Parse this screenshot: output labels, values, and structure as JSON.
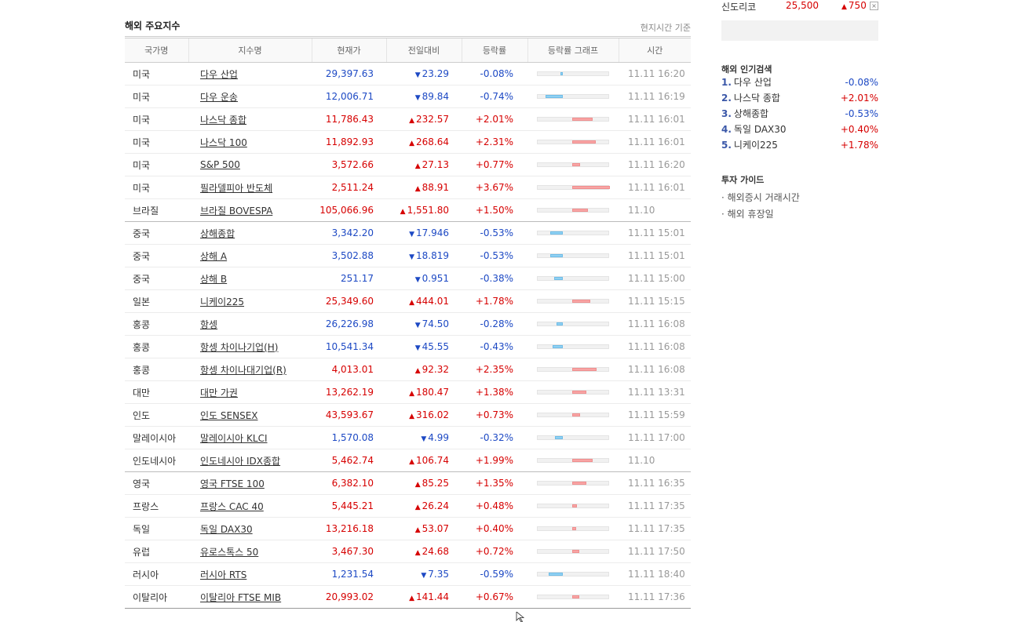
{
  "main": {
    "title": "해외 주요지수",
    "note": "현지시간 기준",
    "columns": [
      "국가명",
      "지수명",
      "현재가",
      "전일대비",
      "등락률",
      "등락률 그래프",
      "시간"
    ],
    "rows": [
      {
        "country": "미국",
        "name": "다우 산업",
        "price": "29,397.63",
        "dir": "dn",
        "change": "23.29",
        "rate": "-0.08%",
        "time": "11.11 16:20"
      },
      {
        "country": "미국",
        "name": "다우 운송",
        "price": "12,006.71",
        "dir": "dn",
        "change": "89.84",
        "rate": "-0.74%",
        "time": "11.11 16:19"
      },
      {
        "country": "미국",
        "name": "나스닥 종합",
        "price": "11,786.43",
        "dir": "up",
        "change": "232.57",
        "rate": "+2.01%",
        "time": "11.11 16:01"
      },
      {
        "country": "미국",
        "name": "나스닥 100",
        "price": "11,892.93",
        "dir": "up",
        "change": "268.64",
        "rate": "+2.31%",
        "time": "11.11 16:01"
      },
      {
        "country": "미국",
        "name": "S&P 500",
        "price": "3,572.66",
        "dir": "up",
        "change": "27.13",
        "rate": "+0.77%",
        "time": "11.11 16:20"
      },
      {
        "country": "미국",
        "name": "필라델피아 반도체",
        "price": "2,511.24",
        "dir": "up",
        "change": "88.91",
        "rate": "+3.67%",
        "time": "11.11 16:01"
      },
      {
        "country": "브라질",
        "name": "브라질 BOVESPA",
        "price": "105,066.96",
        "dir": "up",
        "change": "1,551.80",
        "rate": "+1.50%",
        "time": "11.10",
        "sep": true
      },
      {
        "country": "중국",
        "name": "상해종합",
        "price": "3,342.20",
        "dir": "dn",
        "change": "17.946",
        "rate": "-0.53%",
        "time": "11.11 15:01"
      },
      {
        "country": "중국",
        "name": "상해 A",
        "price": "3,502.88",
        "dir": "dn",
        "change": "18.819",
        "rate": "-0.53%",
        "time": "11.11 15:01"
      },
      {
        "country": "중국",
        "name": "상해 B",
        "price": "251.17",
        "dir": "dn",
        "change": "0.951",
        "rate": "-0.38%",
        "time": "11.11 15:00"
      },
      {
        "country": "일본",
        "name": "니케이225",
        "price": "25,349.60",
        "dir": "up",
        "change": "444.01",
        "rate": "+1.78%",
        "time": "11.11 15:15"
      },
      {
        "country": "홍콩",
        "name": "항셍",
        "price": "26,226.98",
        "dir": "dn",
        "change": "74.50",
        "rate": "-0.28%",
        "time": "11.11 16:08"
      },
      {
        "country": "홍콩",
        "name": "항셍 차이나기업(H)",
        "price": "10,541.34",
        "dir": "dn",
        "change": "45.55",
        "rate": "-0.43%",
        "time": "11.11 16:08"
      },
      {
        "country": "홍콩",
        "name": "항셍 차이나대기업(R)",
        "price": "4,013.01",
        "dir": "up",
        "change": "92.32",
        "rate": "+2.35%",
        "time": "11.11 16:08"
      },
      {
        "country": "대만",
        "name": "대만 가권",
        "price": "13,262.19",
        "dir": "up",
        "change": "180.47",
        "rate": "+1.38%",
        "time": "11.11 13:31"
      },
      {
        "country": "인도",
        "name": "인도 SENSEX",
        "price": "43,593.67",
        "dir": "up",
        "change": "316.02",
        "rate": "+0.73%",
        "time": "11.11 15:59"
      },
      {
        "country": "말레이시아",
        "name": "말레이시아 KLCI",
        "price": "1,570.08",
        "dir": "dn",
        "change": "4.99",
        "rate": "-0.32%",
        "time": "11.11 17:00"
      },
      {
        "country": "인도네시아",
        "name": "인도네시아 IDX종합",
        "price": "5,462.74",
        "dir": "up",
        "change": "106.74",
        "rate": "+1.99%",
        "time": "11.10",
        "sep": true
      },
      {
        "country": "영국",
        "name": "영국 FTSE 100",
        "price": "6,382.10",
        "dir": "up",
        "change": "85.25",
        "rate": "+1.35%",
        "time": "11.11 16:35"
      },
      {
        "country": "프랑스",
        "name": "프랑스 CAC 40",
        "price": "5,445.21",
        "dir": "up",
        "change": "26.24",
        "rate": "+0.48%",
        "time": "11.11 17:35"
      },
      {
        "country": "독일",
        "name": "독일 DAX30",
        "price": "13,216.18",
        "dir": "up",
        "change": "53.07",
        "rate": "+0.40%",
        "time": "11.11 17:35"
      },
      {
        "country": "유럽",
        "name": "유로스톡스 50",
        "price": "3,467.30",
        "dir": "up",
        "change": "24.68",
        "rate": "+0.72%",
        "time": "11.11 17:50"
      },
      {
        "country": "러시아",
        "name": "러시아 RTS",
        "price": "1,231.54",
        "dir": "dn",
        "change": "7.35",
        "rate": "-0.59%",
        "time": "11.11 18:40"
      },
      {
        "country": "이탈리아",
        "name": "이탈리아 FTSE MIB",
        "price": "20,993.02",
        "dir": "up",
        "change": "141.44",
        "rate": "+0.67%",
        "time": "11.11 17:36"
      }
    ]
  },
  "side": {
    "ticker": {
      "name": "신도리코",
      "price": "25,500",
      "change": "750",
      "close_icon": "close-icon"
    },
    "popular_title": "해외 인기검색",
    "popular": [
      {
        "rank": "1.",
        "name": "다우 산업",
        "rate": "-0.08%",
        "dir": "dn"
      },
      {
        "rank": "2.",
        "name": "나스닥 종합",
        "rate": "+2.01%",
        "dir": "up"
      },
      {
        "rank": "3.",
        "name": "상해종합",
        "rate": "-0.53%",
        "dir": "dn"
      },
      {
        "rank": "4.",
        "name": "독일 DAX30",
        "rate": "+0.40%",
        "dir": "up"
      },
      {
        "rank": "5.",
        "name": "니케이225",
        "rate": "+1.78%",
        "dir": "up"
      }
    ],
    "guide_title": "투자 가이드",
    "guide": [
      "해외증시 거래시간",
      "해외 휴장일"
    ]
  },
  "colors": {
    "up": "#d60000",
    "down": "#1d49c4",
    "bar_up": "#f8a4a4",
    "bar_down": "#8fd0f2"
  }
}
